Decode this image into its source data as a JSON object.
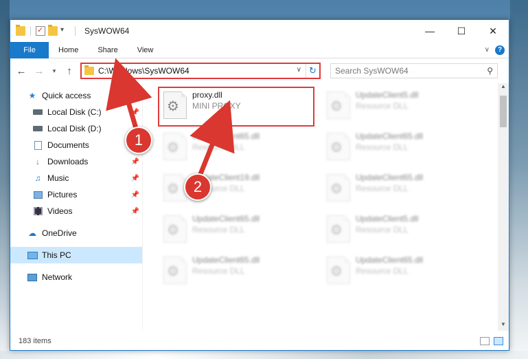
{
  "titlebar": {
    "title": "SysWOW64",
    "minimize": "—",
    "maximize": "☐",
    "close": "✕"
  },
  "ribbon": {
    "file": "File",
    "tabs": [
      "Home",
      "Share",
      "View"
    ],
    "help": "?"
  },
  "address": {
    "path": "C:\\Windows\\SysWOW64",
    "search_placeholder": "Search SysWOW64"
  },
  "sidebar": {
    "quick_access": "Quick access",
    "items": [
      "Local Disk (C:)",
      "Local Disk (D:)",
      "Documents",
      "Downloads",
      "Music",
      "Pictures",
      "Videos"
    ],
    "onedrive": "OneDrive",
    "this_pc": "This PC",
    "network": "Network"
  },
  "files": {
    "highlighted": {
      "name": "proxy.dll",
      "type": "MINI PROXY"
    },
    "others": [
      {
        "name": "UpdateClient5.dll",
        "type": "Resource DLL"
      },
      {
        "name": "UpdateClient65.dll",
        "type": "Resource DLL"
      },
      {
        "name": "UpdateClient65.dll",
        "type": "Resource DLL"
      },
      {
        "name": "UpdateClient19.dll",
        "type": "Resource DLL"
      },
      {
        "name": "UpdateClient65.dll",
        "type": "Resource DLL"
      },
      {
        "name": "UpdateClient65.dll",
        "type": "Resource DLL"
      },
      {
        "name": "UpdateClient5.dll",
        "type": "Resource DLL"
      },
      {
        "name": "UpdateClient65.dll",
        "type": "Resource DLL"
      },
      {
        "name": "UpdateClient65.dll",
        "type": "Resource DLL"
      }
    ]
  },
  "status": {
    "count": "183 items"
  },
  "callouts": [
    "1",
    "2"
  ],
  "colors": {
    "accent": "#1979ca",
    "highlight": "#e03a3a",
    "selected": "#cce8ff"
  }
}
